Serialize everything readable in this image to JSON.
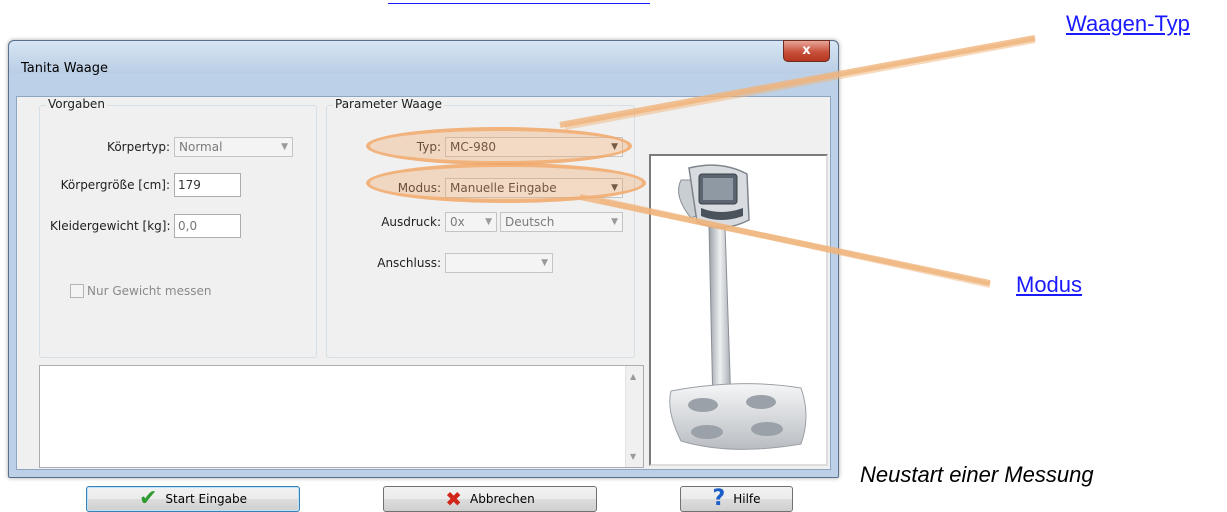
{
  "page": {
    "top_link": "",
    "links": {
      "waagen_typ": "Waagen-Typ",
      "modus": "Modus"
    },
    "caption": "Neustart einer Messung"
  },
  "window": {
    "title": "Tanita Waage",
    "close_glyph": "x"
  },
  "vorgaben": {
    "title": "Vorgaben",
    "koerpertyp_label": "Körpertyp:",
    "koerpertyp_value": "Normal",
    "groesse_label": "Körpergröße [cm]:",
    "groesse_value": "179",
    "kleidergewicht_label": "Kleidergewicht [kg]:",
    "kleidergewicht_value": "0,0",
    "nur_gewicht_label": "Nur Gewicht messen"
  },
  "parameter": {
    "title": "Parameter Waage",
    "typ_label": "Typ:",
    "typ_value": "MC-980",
    "modus_label": "Modus:",
    "modus_value": "Manuelle Eingabe",
    "ausdruck_label": "Ausdruck:",
    "ausdruck_count": "0x",
    "ausdruck_lang": "Deutsch",
    "anschluss_label": "Anschluss:",
    "anschluss_value": ""
  },
  "buttons": {
    "start": "Start Eingabe",
    "abbrechen": "Abbrechen",
    "hilfe": "Hilfe"
  },
  "icons": {
    "start": "check-icon",
    "abbrechen": "x-icon",
    "hilfe": "question-icon",
    "dropdown": "chevron-down-icon"
  },
  "colors": {
    "link": "#1a1aff",
    "highlight": "#f0a564",
    "window_frame": "#bcd1e7"
  }
}
